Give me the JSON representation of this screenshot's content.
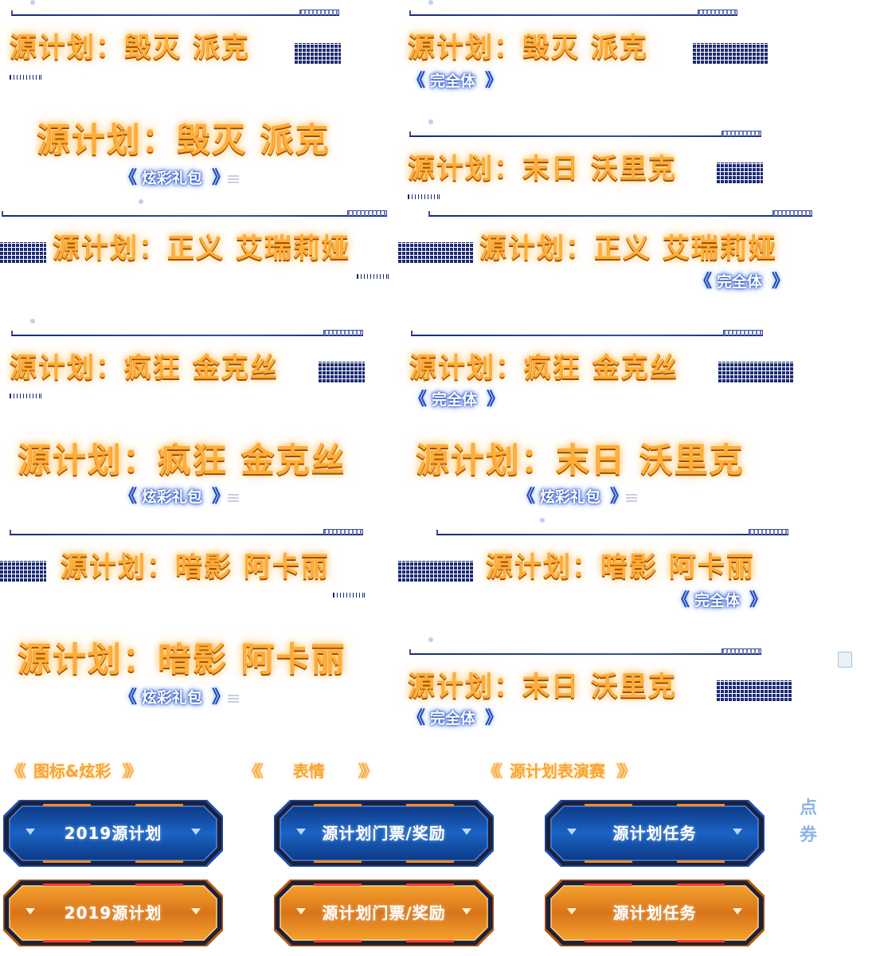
{
  "title_prefix": "源计划：",
  "banners": [
    {
      "kind": "line",
      "title": "源计划：毁灭 派克",
      "sub": ""
    },
    {
      "kind": "line",
      "title": "源计划：毁灭 派克",
      "sub": "完全体"
    },
    {
      "kind": "big",
      "title": "源计划：毁灭 派克",
      "sub": "炫彩礼包"
    },
    {
      "kind": "line",
      "title": "源计划：末日 沃里克",
      "sub": ""
    },
    {
      "kind": "line",
      "title": "源计划：正义 艾瑞莉娅",
      "sub": ""
    },
    {
      "kind": "line",
      "title": "源计划：正义 艾瑞莉娅",
      "sub": "完全体"
    },
    {
      "kind": "line",
      "title": "源计划：疯狂 金克丝",
      "sub": ""
    },
    {
      "kind": "line",
      "title": "源计划：疯狂 金克丝",
      "sub": "完全体"
    },
    {
      "kind": "big",
      "title": "源计划：疯狂 金克丝",
      "sub": "炫彩礼包"
    },
    {
      "kind": "big",
      "title": "源计划：末日 沃里克",
      "sub": "炫彩礼包"
    },
    {
      "kind": "line",
      "title": "源计划：暗影 阿卡丽",
      "sub": ""
    },
    {
      "kind": "line",
      "title": "源计划：暗影 阿卡丽",
      "sub": "完全体"
    },
    {
      "kind": "big",
      "title": "源计划：暗影 阿卡丽",
      "sub": "炫彩礼包"
    },
    {
      "kind": "line",
      "title": "源计划：末日 沃里克",
      "sub": "完全体"
    }
  ],
  "sections": [
    "图标&炫彩",
    "表情",
    "源计划表演赛"
  ],
  "buttons": {
    "blue": [
      "2019源计划",
      "源计划门票/奖励",
      "源计划任务"
    ],
    "orange": [
      "2019源计划",
      "源计划门票/奖励",
      "源计划任务"
    ]
  },
  "side_label": "点券",
  "colors": {
    "title": "#ffad3a",
    "navy": "#1b2a74",
    "blue_glow": "#3c6ff2",
    "btn_blue": "#0f3f8c",
    "btn_orange": "#e58a1a"
  }
}
